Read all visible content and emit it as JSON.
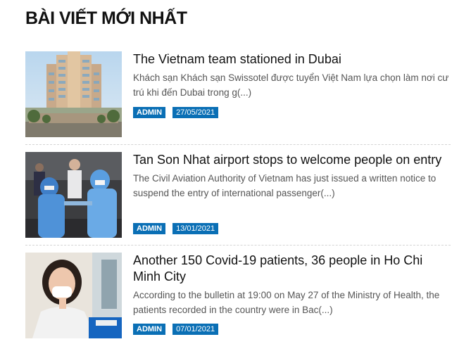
{
  "section": {
    "title": "BÀI VIẾT MỚI NHẤT"
  },
  "posts": [
    {
      "title": "The Vietnam team stationed in Dubai",
      "excerpt": "Khách sạn Khách sạn Swissotel được tuyển Việt Nam lựa chọn làm nơi cư trú khi đến Dubai trong g(...)",
      "author": "ADMIN",
      "date": "27/05/2021",
      "thumb_icon": "hotel-building-photo"
    },
    {
      "title": "Tan Son Nhat airport stops to welcome people on entry",
      "excerpt": "The Civil Aviation Authority of Vietnam has just issued a written notice to suspend the entry of international passenger(...)",
      "author": "ADMIN",
      "date": "13/01/2021",
      "thumb_icon": "airport-health-workers-photo"
    },
    {
      "title": "Another 150 Covid-19 patients, 36 people in Ho Chi Minh City",
      "excerpt": "According to the bulletin at 19:00 on May 27 of the Ministry of Health, the patients recorded in the country were in Bac(...)",
      "author": "ADMIN",
      "date": "07/01/2021",
      "thumb_icon": "vaccination-woman-photo"
    }
  ],
  "colors": {
    "tag_bg": "#0a6fb5",
    "tag_text": "#ffffff",
    "title": "#111111",
    "excerpt": "#555555"
  }
}
